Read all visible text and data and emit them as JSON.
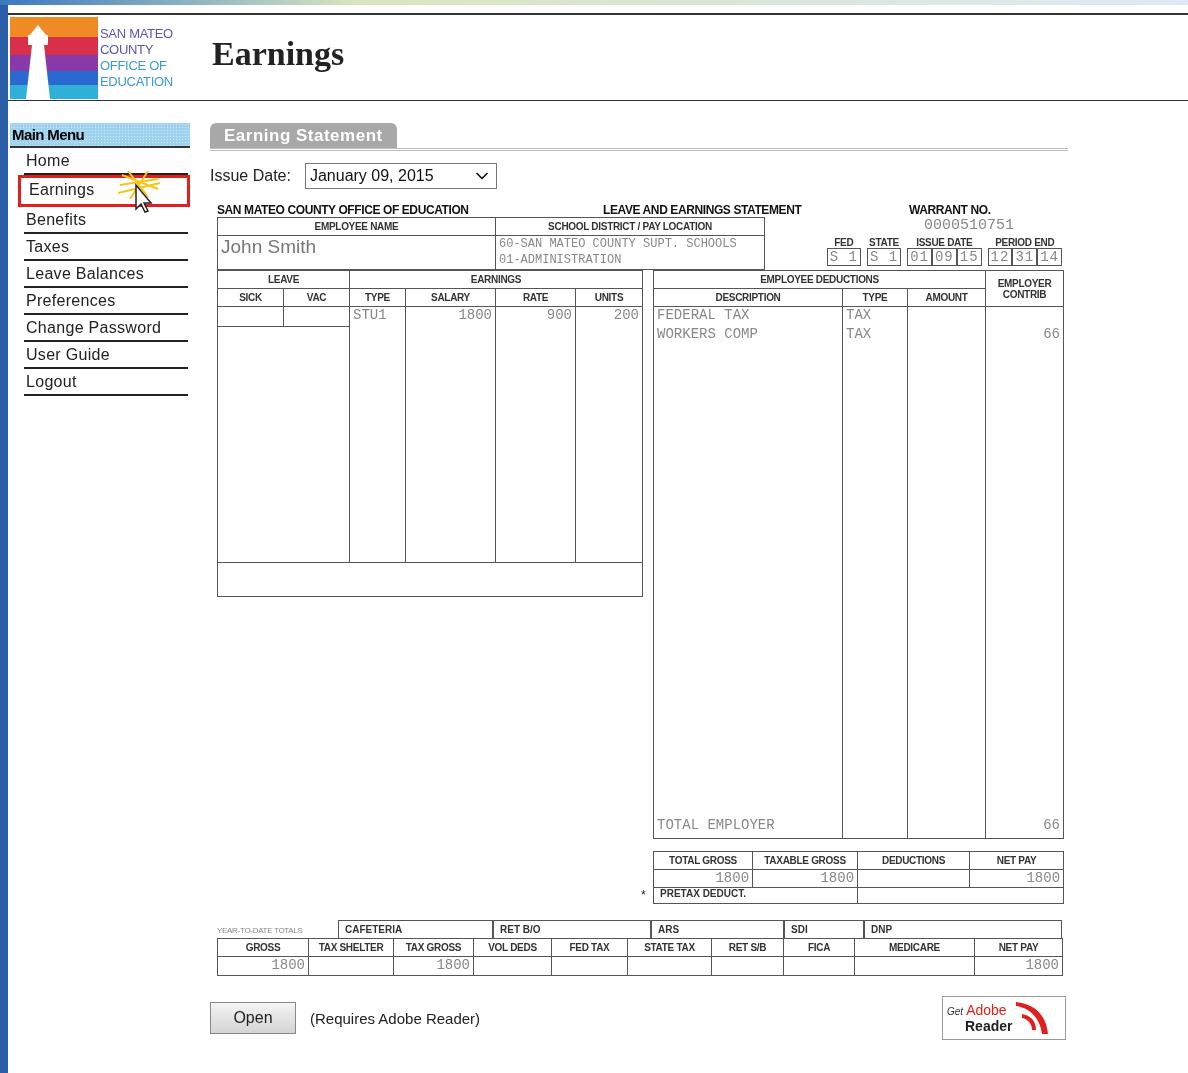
{
  "logo": {
    "lines": [
      "SAN MATEO",
      "COUNTY",
      "OFFICE OF",
      "EDUCATION"
    ]
  },
  "page_title": "Earnings",
  "menu": {
    "title": "Main Menu",
    "items": [
      {
        "label": "Home",
        "selected": false
      },
      {
        "label": "Earnings",
        "selected": true
      },
      {
        "label": "Benefits",
        "selected": false
      },
      {
        "label": "Taxes",
        "selected": false
      },
      {
        "label": "Leave Balances",
        "selected": false
      },
      {
        "label": "Preferences",
        "selected": false
      },
      {
        "label": "Change Password",
        "selected": false
      },
      {
        "label": "User Guide",
        "selected": false
      },
      {
        "label": "Logout",
        "selected": false
      }
    ]
  },
  "section_title": "Earning Statement",
  "issue_date": {
    "label": "Issue Date:",
    "value": "January 09, 2015"
  },
  "statement": {
    "org": "SAN MATEO COUNTY OFFICE OF EDUCATION",
    "title": "LEAVE AND EARNINGS STATEMENT",
    "warrant_label": "WARRANT NO.",
    "warrant_no": "0000510751",
    "employee_name_label": "EMPLOYEE NAME",
    "employee_name": "John Smith",
    "location_label": "SCHOOL DISTRICT / PAY LOCATION",
    "location_lines": [
      "60-SAN MATEO COUNTY SUPT. SCHOOLS",
      "01-ADMINISTRATION"
    ],
    "codes": [
      {
        "label": "FED",
        "parts": [
          "S 1"
        ]
      },
      {
        "label": "STATE",
        "parts": [
          "S 1"
        ]
      },
      {
        "label": "ISSUE DATE",
        "parts": [
          "01",
          "09",
          "15"
        ]
      },
      {
        "label": "PERIOD END",
        "parts": [
          "12",
          "31",
          "14"
        ]
      }
    ],
    "leave": {
      "title": "LEAVE",
      "columns": [
        "SICK",
        "VAC"
      ]
    },
    "earnings": {
      "title": "EARNINGS",
      "columns": [
        "TYPE",
        "SALARY",
        "RATE",
        "UNITS"
      ],
      "rows": [
        [
          "STU1",
          "1800",
          "900",
          "200"
        ]
      ]
    },
    "deductions": {
      "title": "EMPLOYEE DEDUCTIONS",
      "columns": [
        "DESCRIPTION",
        "TYPE",
        "AMOUNT"
      ],
      "employer_label": "EMPLOYER CONTRIB",
      "rows": [
        {
          "description": "FEDERAL TAX",
          "type": "TAX"
        },
        {
          "description": "WORKERS COMP",
          "type": "TAX",
          "employer": "66"
        }
      ],
      "total": {
        "label": "TOTAL EMPLOYER",
        "employer": "66"
      }
    },
    "totals": {
      "columns": [
        {
          "label": "TOTAL GROSS",
          "value": "1800"
        },
        {
          "label": "TAXABLE GROSS",
          "value": "1800"
        },
        {
          "label": "DEDUCTIONS"
        },
        {
          "label": "NET PAY",
          "value": "1800"
        }
      ],
      "pretax_mark": "*",
      "pretax_label": "PRETAX DEDUCT."
    },
    "ytd": {
      "label": "YEAR-TO-DATE TOTALS",
      "top": [
        "CAFETERIA",
        "RET B/O",
        "ARS",
        "SDI",
        "DNP"
      ],
      "columns": [
        {
          "label": "GROSS",
          "value": "1800"
        },
        {
          "label": "TAX SHELTER"
        },
        {
          "label": "TAX GROSS",
          "value": "1800"
        },
        {
          "label": "VOL DEDS"
        },
        {
          "label": "FED TAX"
        },
        {
          "label": "STATE TAX"
        },
        {
          "label": "RET S/B"
        },
        {
          "label": "FICA"
        },
        {
          "label": "MEDICARE"
        },
        {
          "label": "NET PAY",
          "value": "1800"
        }
      ]
    }
  },
  "open_button": "Open",
  "requires_note": "(Requires Adobe Reader)",
  "adobe_badge": {
    "get": "Get",
    "brand": "Adobe",
    "product": "Reader"
  }
}
